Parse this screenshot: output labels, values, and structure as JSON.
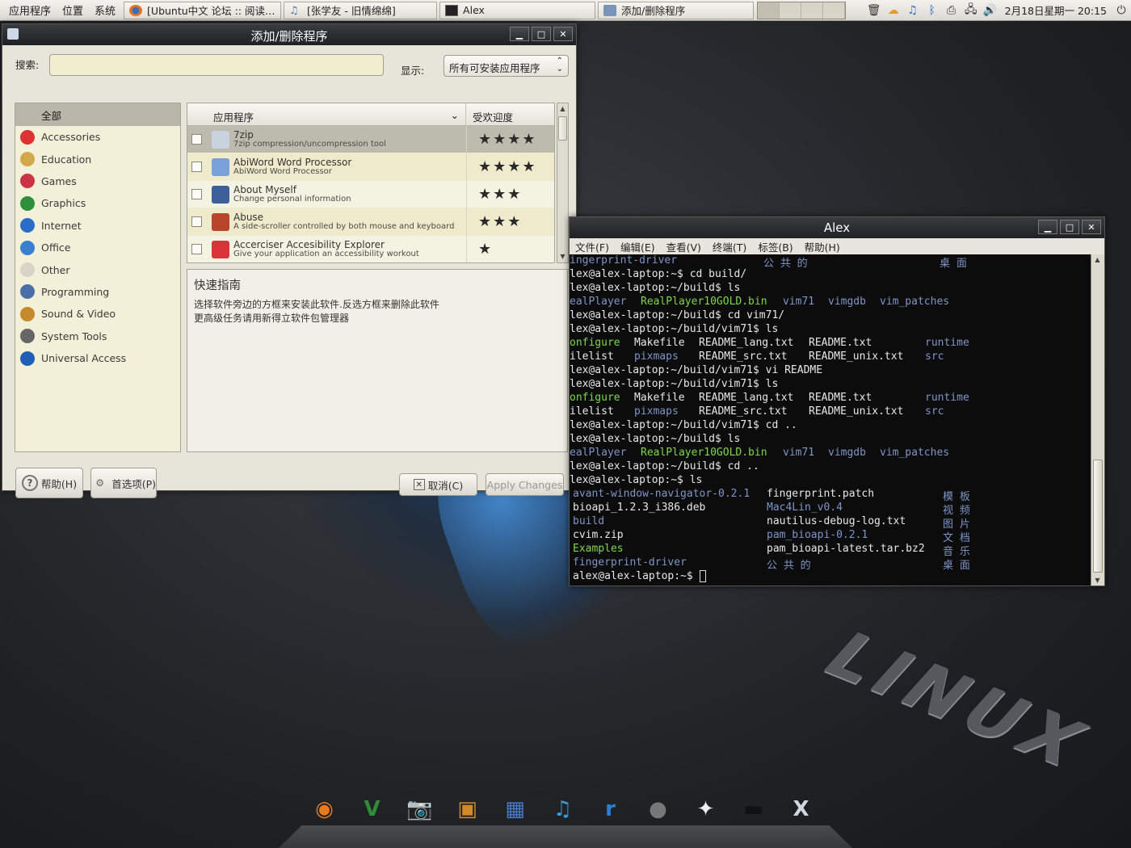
{
  "top_panel": {
    "menus": [
      "应用程序",
      "位置",
      "系统"
    ],
    "tasks": [
      {
        "label": "[Ubuntu中文 论坛 :: 阅读…",
        "icon": "firefox-icon",
        "color": "#e8721c"
      },
      {
        "label": "[张学友 - 旧情绵绵]",
        "icon": "music-note-icon",
        "color": "#5577aa"
      },
      {
        "label": "Alex",
        "icon": "terminal-icon",
        "color": "#222222"
      },
      {
        "label": "添加/删除程序",
        "icon": "package-icon",
        "color": "#7a94b8"
      }
    ],
    "clock": "2月18日星期一 20:15"
  },
  "addremove": {
    "title": "添加/删除程序",
    "search_label": "搜索:",
    "search_value": "",
    "show_label": "显示:",
    "show_value": "所有可安装应用程序",
    "categories": [
      {
        "label": "全部",
        "icon": "apple-icon",
        "color": "#1a1a1a",
        "selected": true
      },
      {
        "label": "Accessories",
        "icon": "accessories-icon",
        "color": "#d33"
      },
      {
        "label": "Education",
        "icon": "education-icon",
        "color": "#d5a74c"
      },
      {
        "label": "Games",
        "icon": "games-icon",
        "color": "#c34"
      },
      {
        "label": "Graphics",
        "icon": "graphics-icon",
        "color": "#2f8f3a"
      },
      {
        "label": "Internet",
        "icon": "internet-icon",
        "color": "#2a6dc9"
      },
      {
        "label": "Office",
        "icon": "office-icon",
        "color": "#3a7fd0"
      },
      {
        "label": "Other",
        "icon": "other-icon",
        "color": "#d8d4c8"
      },
      {
        "label": "Programming",
        "icon": "programming-icon",
        "color": "#4a6fa8"
      },
      {
        "label": "Sound & Video",
        "icon": "sound-video-icon",
        "color": "#c58a2c"
      },
      {
        "label": "System Tools",
        "icon": "system-tools-icon",
        "color": "#666"
      },
      {
        "label": "Universal Access",
        "icon": "universal-access-icon",
        "color": "#1f5fb8"
      }
    ],
    "table_headers": {
      "app": "应用程序",
      "popularity": "受欢迎度"
    },
    "apps": [
      {
        "name": "7zip",
        "desc": "7zip compression/uncompression tool",
        "stars": "★★★★",
        "icon_color": "#c9d3e0"
      },
      {
        "name": "AbiWord Word Processor",
        "desc": "AbiWord Word Processor",
        "stars": "★★★★",
        "icon_color": "#7aa0d8"
      },
      {
        "name": "About Myself",
        "desc": "Change personal information",
        "stars": "★★★",
        "icon_color": "#3d5f9a"
      },
      {
        "name": "Abuse",
        "desc": "A side-scroller controlled by both mouse and keyboard",
        "stars": "★★★",
        "icon_color": "#b8442a"
      },
      {
        "name": "Accerciser Accesibility Explorer",
        "desc": "Give your application an accessibility workout",
        "stars": "★",
        "icon_color": "#d8343a"
      }
    ],
    "guide": {
      "title": "快速指南",
      "line1": "选择软件旁边的方框来安装此软件.反选方框来删除此软件",
      "line2": "更高级任务请用新得立软件包管理器"
    },
    "buttons": {
      "help": "帮助(H)",
      "prefs": "首选项(P)",
      "cancel": "取消(C)",
      "apply": "Apply Changes"
    }
  },
  "terminal": {
    "title": "Alex",
    "menu": [
      "文件(F)",
      "编辑(E)",
      "查看(V)",
      "终端(T)",
      "标签(B)",
      "帮助(H)"
    ]
  },
  "dock": {
    "items": [
      {
        "icon": "firefox-icon",
        "glyph": "◉",
        "color": "#e87a1e"
      },
      {
        "icon": "vim-icon",
        "glyph": "V",
        "color": "#2f8d3a"
      },
      {
        "icon": "camera-icon",
        "glyph": "📷",
        "color": "#555"
      },
      {
        "icon": "image-viewer-icon",
        "glyph": "▣",
        "color": "#d08a2a"
      },
      {
        "icon": "movie-icon",
        "glyph": "▦",
        "color": "#4a7ac8"
      },
      {
        "icon": "music-icon",
        "glyph": "♫",
        "color": "#3a9ad8"
      },
      {
        "icon": "realplayer-icon",
        "glyph": "r",
        "color": "#2b7fd4"
      },
      {
        "icon": "gimp-icon",
        "glyph": "●",
        "color": "#777"
      },
      {
        "icon": "aim-icon",
        "glyph": "✦",
        "color": "#eee"
      },
      {
        "icon": "terminal-icon",
        "glyph": "▬",
        "color": "#111"
      },
      {
        "icon": "xchat-icon",
        "glyph": "X",
        "color": "#cfd6e0"
      }
    ]
  }
}
